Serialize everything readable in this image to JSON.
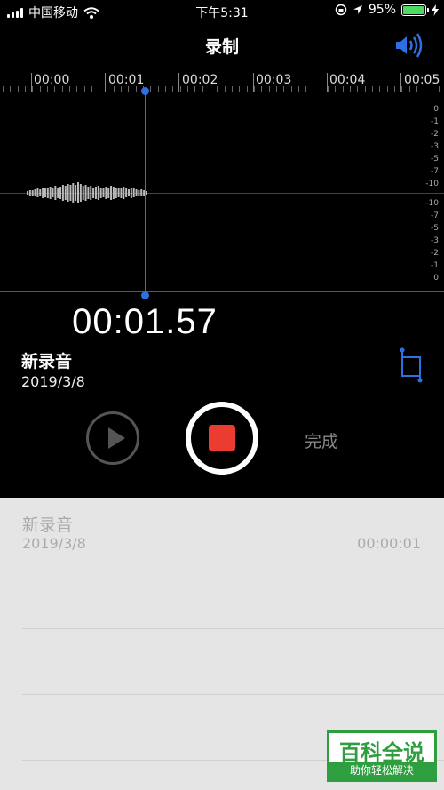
{
  "status_bar": {
    "carrier": "中国移动",
    "time": "下午5:31",
    "battery_percent": "95%",
    "battery_level": 0.95
  },
  "nav": {
    "title": "录制",
    "speaker_icon": "speaker-icon",
    "accent_color": "#2f6fe4"
  },
  "ruler": {
    "labels": [
      "00:00",
      "00:01",
      "00:02",
      "00:03",
      "00:04",
      "00:05"
    ]
  },
  "levels": {
    "top": [
      "0",
      "-1",
      "-2",
      "-3",
      "-5",
      "-7",
      "-10"
    ],
    "bottom": [
      "-10",
      "-7",
      "-5",
      "-3",
      "-2",
      "-1",
      "0"
    ]
  },
  "recording": {
    "elapsed": "00:01.57",
    "name": "新录音",
    "date": "2019/3/8",
    "record_color": "#ec3b30"
  },
  "controls": {
    "play_icon": "play-icon",
    "stop_icon": "stop-icon",
    "done_label": "完成"
  },
  "list": {
    "items": [
      {
        "name": "新录音",
        "date": "2019/3/8",
        "duration": "00:00:01"
      }
    ]
  },
  "watermark": {
    "top": "百科全说",
    "bottom": "助你轻松解决"
  }
}
